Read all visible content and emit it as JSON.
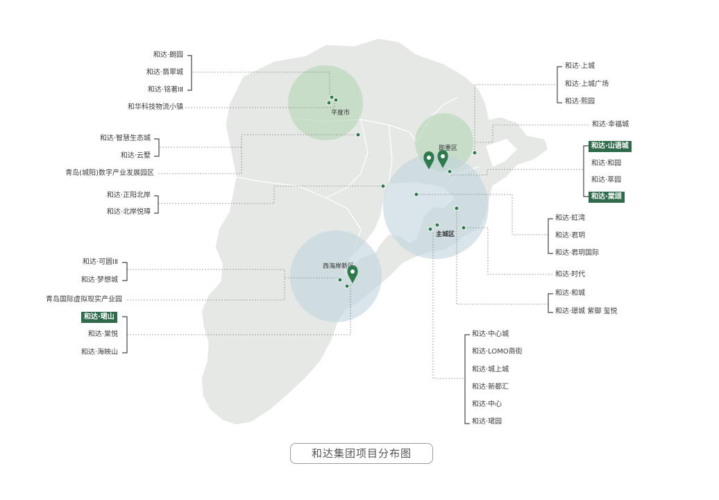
{
  "caption": "和达集团项目分布图",
  "colors": {
    "land": "#e6e8e6",
    "highlight": "#2f6b4a",
    "green_circle": "#b8d6b8",
    "blue_circle": "#c2d6df",
    "marker": "#2f7a4c"
  },
  "icons": [
    "map-pin-icon",
    "location-dot-icon"
  ],
  "districts": {
    "pingdu": "平度市",
    "jimo": "即墨区",
    "main_city": "主城区",
    "west_coast": "西海岸新区"
  },
  "groups": {
    "pingdu": [
      "和达·朗园",
      "和达·翡翠城",
      "和达·铭著ⅠⅡ",
      "和华科技物流小镇"
    ],
    "chengyang": [
      "和达·智慧生态城",
      "和达·云墅",
      "青岛(城阳)数字产业发展园区"
    ],
    "zhengyang": [
      "和达·正阳北岸",
      "和达·北岸悦璋"
    ],
    "westcoast_a": [
      "和达·可圆ⅠⅡ",
      "和达·梦想城",
      "青岛国际虚拟现实产业园"
    ],
    "westcoast_b": [
      "和达·珺山",
      "和达·棠悦",
      "和达·海映山"
    ],
    "jimo_a": [
      "和达·上城",
      "和达·上城广场",
      "和达·熙园"
    ],
    "jimo_single": [
      "和达·幸福城"
    ],
    "laoshan": [
      "和达·山语城",
      "和达·和园",
      "和达·萃园",
      "和达·棠颂"
    ],
    "licang": [
      "和达·虹湾",
      "和达·君玥",
      "和达·君玥国际"
    ],
    "shidai": [
      "和达·时代"
    ],
    "hecheng": [
      "和达·和城",
      "和达·璟城 紫御 玺悦"
    ],
    "shinan": [
      "和达·中心城",
      "和达·LOMO商街",
      "和达·城上城",
      "和达·新都汇",
      "和达·中心",
      "和达·珺园"
    ]
  }
}
